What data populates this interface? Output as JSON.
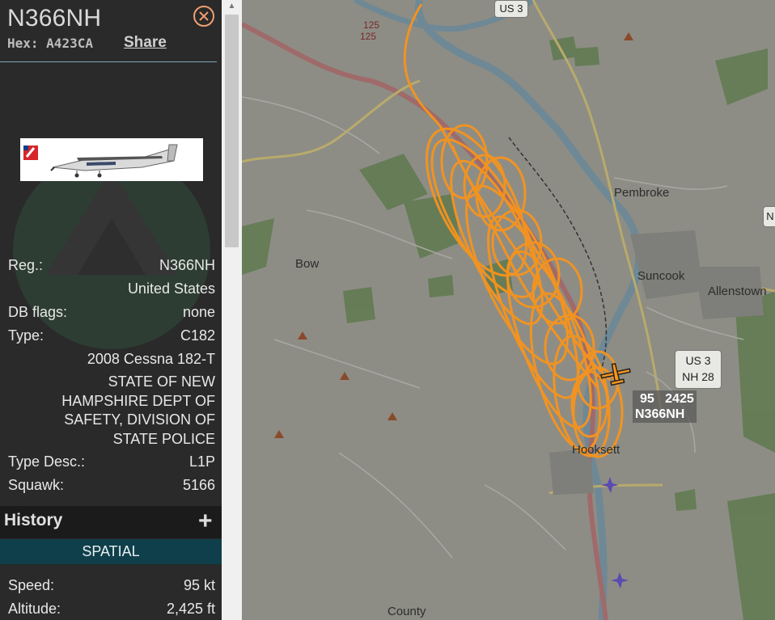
{
  "aircraft": {
    "title": "N366NH",
    "hex_label": "Hex:",
    "hex_value": "A423CA",
    "share_label": "Share"
  },
  "details": {
    "reg_label": "Reg.:",
    "reg_value": "N366NH",
    "country": "United States",
    "dbflags_label": "DB flags:",
    "dbflags_value": "none",
    "type_label": "Type:",
    "type_value": "C182",
    "type_full": "2008 Cessna 182-T",
    "owner_lines": [
      "STATE OF NEW",
      "HAMPSHIRE DEPT OF",
      "SAFETY, DIVISION OF",
      "STATE POLICE"
    ],
    "typedesc_label": "Type Desc.:",
    "typedesc_value": "L1P",
    "squawk_label": "Squawk:",
    "squawk_value": "5166"
  },
  "history": {
    "label": "History",
    "expand_icon": "plus-icon"
  },
  "spatial": {
    "label": "SPATIAL",
    "speed_label": "Speed:",
    "speed_value": "95 kt",
    "altitude_label": "Altitude:",
    "altitude_value": "2,425 ft"
  },
  "map": {
    "places": [
      "Pembroke",
      "Suncook",
      "Allenstown",
      "Bow",
      "Hooksett",
      "County"
    ],
    "shields": {
      "us3_top": "US 3",
      "us3_right_a": "US 3",
      "nh28": "NH 28",
      "n_right": "N",
      "i125_a": "125",
      "i125_b": "125"
    },
    "aircraft_label": {
      "speed": "95",
      "altitude": "2425",
      "callsign": "N366NH"
    },
    "track_color": "#f7941d",
    "plane_color": "#f7941d"
  }
}
